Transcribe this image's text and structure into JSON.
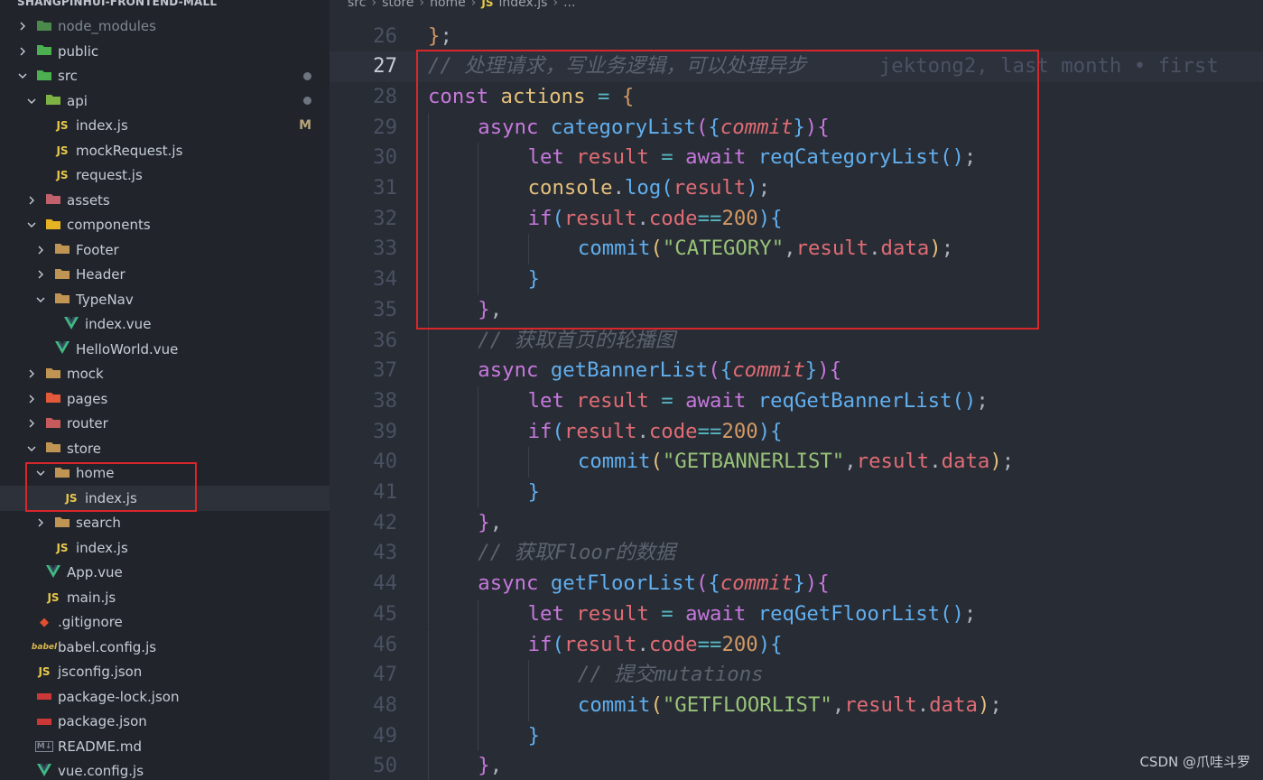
{
  "project_title": "SHANGPINHUI-FRONTEND-MALL",
  "breadcrumb": [
    "src",
    "store",
    "home",
    "index.js",
    "..."
  ],
  "sidebar": {
    "items": [
      {
        "label": "node_modules",
        "depth": 0,
        "expanded": false,
        "icon": "node-folder-icon",
        "dim": true
      },
      {
        "label": "public",
        "depth": 0,
        "expanded": false,
        "icon": "public-folder-icon"
      },
      {
        "label": "src",
        "depth": 0,
        "expanded": true,
        "icon": "src-folder-icon",
        "modified": true
      },
      {
        "label": "api",
        "depth": 1,
        "expanded": true,
        "icon": "api-folder-icon",
        "modified": true
      },
      {
        "label": "index.js",
        "depth": 2,
        "icon": "js-file-icon",
        "badge": "M"
      },
      {
        "label": "mockRequest.js",
        "depth": 2,
        "icon": "js-file-icon"
      },
      {
        "label": "request.js",
        "depth": 2,
        "icon": "js-file-icon"
      },
      {
        "label": "assets",
        "depth": 1,
        "expanded": false,
        "icon": "assets-folder-icon"
      },
      {
        "label": "components",
        "depth": 1,
        "expanded": true,
        "icon": "components-folder-icon"
      },
      {
        "label": "Footer",
        "depth": 2,
        "expanded": false,
        "icon": "folder-icon"
      },
      {
        "label": "Header",
        "depth": 2,
        "expanded": false,
        "icon": "folder-icon"
      },
      {
        "label": "TypeNav",
        "depth": 2,
        "expanded": true,
        "icon": "folder-icon"
      },
      {
        "label": "index.vue",
        "depth": 3,
        "icon": "vue-file-icon"
      },
      {
        "label": "HelloWorld.vue",
        "depth": 2,
        "icon": "vue-file-icon"
      },
      {
        "label": "mock",
        "depth": 1,
        "expanded": false,
        "icon": "folder-icon"
      },
      {
        "label": "pages",
        "depth": 1,
        "expanded": false,
        "icon": "pages-folder-icon"
      },
      {
        "label": "router",
        "depth": 1,
        "expanded": false,
        "icon": "router-folder-icon"
      },
      {
        "label": "store",
        "depth": 1,
        "expanded": true,
        "icon": "folder-icon"
      },
      {
        "label": "home",
        "depth": 2,
        "expanded": true,
        "icon": "folder-icon"
      },
      {
        "label": "index.js",
        "depth": 3,
        "icon": "js-file-icon",
        "active": true
      },
      {
        "label": "search",
        "depth": 2,
        "expanded": false,
        "icon": "folder-icon"
      },
      {
        "label": "index.js",
        "depth": 2,
        "icon": "js-file-icon"
      },
      {
        "label": "App.vue",
        "depth": 1,
        "icon": "vue-file-icon"
      },
      {
        "label": "main.js",
        "depth": 1,
        "icon": "js-file-icon"
      },
      {
        "label": ".gitignore",
        "depth": 0,
        "icon": "git-icon"
      },
      {
        "label": "babel.config.js",
        "depth": 0,
        "icon": "babel-icon"
      },
      {
        "label": "jsconfig.json",
        "depth": 0,
        "icon": "js-file-icon"
      },
      {
        "label": "package-lock.json",
        "depth": 0,
        "icon": "npm-icon"
      },
      {
        "label": "package.json",
        "depth": 0,
        "icon": "npm-icon"
      },
      {
        "label": "README.md",
        "depth": 0,
        "icon": "markdown-icon"
      },
      {
        "label": "vue.config.js",
        "depth": 0,
        "icon": "vue-file-icon"
      }
    ]
  },
  "editor": {
    "current_line": 27,
    "lines": [
      {
        "n": "26",
        "indent": 0,
        "tokens": [
          [
            "b1",
            "}"
          ],
          [
            "plain",
            ";"
          ]
        ]
      },
      {
        "n": "27",
        "indent": 0,
        "tokens": [
          [
            "c",
            "// 处理请求，写业务逻辑，可以处理异步"
          ],
          [
            "blame",
            "      jektong2, last month • first"
          ]
        ]
      },
      {
        "n": "28",
        "indent": 0,
        "tokens": [
          [
            "k",
            "const "
          ],
          [
            "y",
            "actions"
          ],
          [
            "plain",
            " "
          ],
          [
            "o",
            "="
          ],
          [
            "plain",
            " "
          ],
          [
            "b1",
            "{"
          ]
        ]
      },
      {
        "n": "29",
        "indent": 1,
        "tokens": [
          [
            "k",
            "async "
          ],
          [
            "f",
            "categoryList"
          ],
          [
            "b2",
            "("
          ],
          [
            "b3",
            "{"
          ],
          [
            "p",
            "commit"
          ],
          [
            "b3",
            "}"
          ],
          [
            "b2",
            ")"
          ],
          [
            "b2",
            "{"
          ]
        ]
      },
      {
        "n": "30",
        "indent": 2,
        "tokens": [
          [
            "k",
            "let "
          ],
          [
            "v",
            "result"
          ],
          [
            "plain",
            " "
          ],
          [
            "o",
            "="
          ],
          [
            "plain",
            " "
          ],
          [
            "k",
            "await "
          ],
          [
            "f",
            "reqCategoryList"
          ],
          [
            "b3",
            "()"
          ],
          [
            "plain",
            ";"
          ]
        ]
      },
      {
        "n": "31",
        "indent": 2,
        "tokens": [
          [
            "y",
            "console"
          ],
          [
            "plain",
            "."
          ],
          [
            "f",
            "log"
          ],
          [
            "b3",
            "("
          ],
          [
            "v",
            "result"
          ],
          [
            "b3",
            ")"
          ],
          [
            "plain",
            ";"
          ]
        ]
      },
      {
        "n": "32",
        "indent": 2,
        "tokens": [
          [
            "k",
            "if"
          ],
          [
            "b3",
            "("
          ],
          [
            "v",
            "result"
          ],
          [
            "plain",
            "."
          ],
          [
            "v",
            "code"
          ],
          [
            "o",
            "=="
          ],
          [
            "n",
            "200"
          ],
          [
            "b3",
            ")"
          ],
          [
            "b3",
            "{"
          ]
        ]
      },
      {
        "n": "33",
        "indent": 3,
        "tokens": [
          [
            "f",
            "commit"
          ],
          [
            "bl",
            "("
          ],
          [
            "s",
            "\"CATEGORY\""
          ],
          [
            "plain",
            ","
          ],
          [
            "v",
            "result"
          ],
          [
            "plain",
            "."
          ],
          [
            "v",
            "data"
          ],
          [
            "bl",
            ")"
          ],
          [
            "plain",
            ";"
          ]
        ]
      },
      {
        "n": "34",
        "indent": 2,
        "tokens": [
          [
            "b3",
            "}"
          ]
        ]
      },
      {
        "n": "35",
        "indent": 1,
        "tokens": [
          [
            "b2",
            "}"
          ],
          [
            "plain",
            ","
          ]
        ]
      },
      {
        "n": "36",
        "indent": 1,
        "tokens": [
          [
            "c",
            "// 获取首页的轮播图"
          ]
        ]
      },
      {
        "n": "37",
        "indent": 1,
        "tokens": [
          [
            "k",
            "async "
          ],
          [
            "f",
            "getBannerList"
          ],
          [
            "b2",
            "("
          ],
          [
            "b3",
            "{"
          ],
          [
            "p",
            "commit"
          ],
          [
            "b3",
            "}"
          ],
          [
            "b2",
            ")"
          ],
          [
            "b2",
            "{"
          ]
        ]
      },
      {
        "n": "38",
        "indent": 2,
        "tokens": [
          [
            "k",
            "let "
          ],
          [
            "v",
            "result"
          ],
          [
            "plain",
            " "
          ],
          [
            "o",
            "="
          ],
          [
            "plain",
            " "
          ],
          [
            "k",
            "await "
          ],
          [
            "f",
            "reqGetBannerList"
          ],
          [
            "b3",
            "()"
          ],
          [
            "plain",
            ";"
          ]
        ]
      },
      {
        "n": "39",
        "indent": 2,
        "tokens": [
          [
            "k",
            "if"
          ],
          [
            "b3",
            "("
          ],
          [
            "v",
            "result"
          ],
          [
            "plain",
            "."
          ],
          [
            "v",
            "code"
          ],
          [
            "o",
            "=="
          ],
          [
            "n",
            "200"
          ],
          [
            "b3",
            ")"
          ],
          [
            "b3",
            "{"
          ]
        ]
      },
      {
        "n": "40",
        "indent": 3,
        "tokens": [
          [
            "f",
            "commit"
          ],
          [
            "bl",
            "("
          ],
          [
            "s",
            "\"GETBANNERLIST\""
          ],
          [
            "plain",
            ","
          ],
          [
            "v",
            "result"
          ],
          [
            "plain",
            "."
          ],
          [
            "v",
            "data"
          ],
          [
            "bl",
            ")"
          ],
          [
            "plain",
            ";"
          ]
        ]
      },
      {
        "n": "41",
        "indent": 2,
        "tokens": [
          [
            "b3",
            "}"
          ]
        ]
      },
      {
        "n": "42",
        "indent": 1,
        "tokens": [
          [
            "b2",
            "}"
          ],
          [
            "plain",
            ","
          ]
        ]
      },
      {
        "n": "43",
        "indent": 1,
        "tokens": [
          [
            "c",
            "// 获取Floor的数据"
          ]
        ]
      },
      {
        "n": "44",
        "indent": 1,
        "tokens": [
          [
            "k",
            "async "
          ],
          [
            "f",
            "getFloorList"
          ],
          [
            "b2",
            "("
          ],
          [
            "b3",
            "{"
          ],
          [
            "p",
            "commit"
          ],
          [
            "b3",
            "}"
          ],
          [
            "b2",
            ")"
          ],
          [
            "b2",
            "{"
          ]
        ]
      },
      {
        "n": "45",
        "indent": 2,
        "tokens": [
          [
            "k",
            "let "
          ],
          [
            "v",
            "result"
          ],
          [
            "plain",
            " "
          ],
          [
            "o",
            "="
          ],
          [
            "plain",
            " "
          ],
          [
            "k",
            "await "
          ],
          [
            "f",
            "reqGetFloorList"
          ],
          [
            "b3",
            "()"
          ],
          [
            "plain",
            ";"
          ]
        ]
      },
      {
        "n": "46",
        "indent": 2,
        "tokens": [
          [
            "k",
            "if"
          ],
          [
            "b3",
            "("
          ],
          [
            "v",
            "result"
          ],
          [
            "plain",
            "."
          ],
          [
            "v",
            "code"
          ],
          [
            "o",
            "=="
          ],
          [
            "n",
            "200"
          ],
          [
            "b3",
            ")"
          ],
          [
            "b3",
            "{"
          ]
        ]
      },
      {
        "n": "47",
        "indent": 3,
        "tokens": [
          [
            "c",
            "// 提交mutations"
          ]
        ]
      },
      {
        "n": "48",
        "indent": 3,
        "tokens": [
          [
            "f",
            "commit"
          ],
          [
            "bl",
            "("
          ],
          [
            "s",
            "\"GETFLOORLIST\""
          ],
          [
            "plain",
            ","
          ],
          [
            "v",
            "result"
          ],
          [
            "plain",
            "."
          ],
          [
            "v",
            "data"
          ],
          [
            "bl",
            ")"
          ],
          [
            "plain",
            ";"
          ]
        ]
      },
      {
        "n": "49",
        "indent": 2,
        "tokens": [
          [
            "b3",
            "}"
          ]
        ]
      },
      {
        "n": "50",
        "indent": 1,
        "tokens": [
          [
            "b2",
            "}"
          ],
          [
            "plain",
            ","
          ]
        ]
      }
    ]
  },
  "watermark": "CSDN @爪哇斗罗",
  "colors": {
    "sidebar_bg": "#21252b",
    "editor_bg": "#282c34",
    "highlight_box": "#d9262b",
    "js_icon": "#e8c94a",
    "vue_icon": "#41b883"
  }
}
